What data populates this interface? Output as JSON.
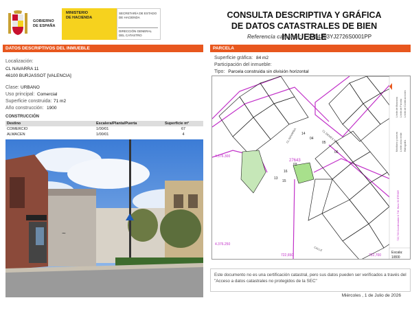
{
  "header": {
    "gov_line1": "GOBIERNO",
    "gov_line2": "DE ESPAÑA",
    "ministry_line1": "MINISTERIO",
    "ministry_line2": "DE HACIENDA",
    "secretaria_line1": "SECRETARÍA DE ESTADO",
    "secretaria_line2": "DE HACIENDA",
    "direccion_line1": "DIRECCIÓN GENERAL",
    "direccion_line2": "DEL CATASTRO",
    "title_line1": "CONSULTA DESCRIPTIVA Y GRÁFICA",
    "title_line2": "DE DATOS CATASTRALES DE BIEN INMUEBLE",
    "refcat_label": "Referencia catastral:",
    "refcat_value": "2764303YJ2726S0001PP"
  },
  "left": {
    "section_title": "DATOS DESCRIPTIVOS DEL INMUEBLE",
    "localizacion_label": "Localización:",
    "address_line1": "CL NAVARRA 11",
    "address_line2": "46100 BURJASSOT [VALENCIA]",
    "clase_label": "Clase:",
    "clase_value": "URBANO",
    "uso_label": "Uso principal:",
    "uso_value": "Comercial",
    "superficie_label": "Superficie construida:",
    "superficie_value": "71 m2",
    "anio_label": "Año construcción:",
    "anio_value": "1900",
    "construccion_label": "CONSTRUCCIÓN",
    "table": {
      "headers": [
        "Destino",
        "Escalera/Planta/Puerta",
        "Superficie m²"
      ],
      "rows": [
        [
          "COMERCIO",
          "1/00/01",
          "67"
        ],
        [
          "ALMACEN",
          "1/00/01",
          "4"
        ]
      ]
    }
  },
  "right": {
    "section_title": "PARCELA",
    "superficie_grafica_label": "Superficie gráfica:",
    "superficie_grafica_value": "84 m2",
    "participacion_label": "Participación del inmueble:",
    "tipo_label": "Tipo:",
    "tipo_value": "Parcela construida sin división horizontal",
    "map": {
      "coord_y1": "4.376.300",
      "coord_y2": "4.376.250",
      "coord_x1": "722,650",
      "coord_x2": "722,700",
      "street1": "CL NAVARRA",
      "street2": "CL DEMES MAS",
      "street3": "CALLE",
      "lot_number": "27643",
      "parcel_labels": [
        "04",
        "03",
        "05",
        "06",
        "14",
        "16",
        "15",
        "13"
      ],
      "escala_label": "Escala:",
      "escala_value": "1/800",
      "side_text": "722,700 Coordenadas U.T.M. Huso 30 ETRS89",
      "legend1": "Límite de Manzana",
      "legend2": "Límite de Parcela",
      "legend3": "Límite de Construcciones",
      "legend4": "Mobiliario y aceras",
      "legend5": "Límite zona verde",
      "legend6": "Hidrografía"
    },
    "disclaimer": "Este documento no es una certificación catastral, pero sus datos pueden ser verificados a través del \"Acceso a datos catastrales no protegidos de la SEC\"",
    "date": "Miércoles , 1 de Julio de 2026"
  }
}
